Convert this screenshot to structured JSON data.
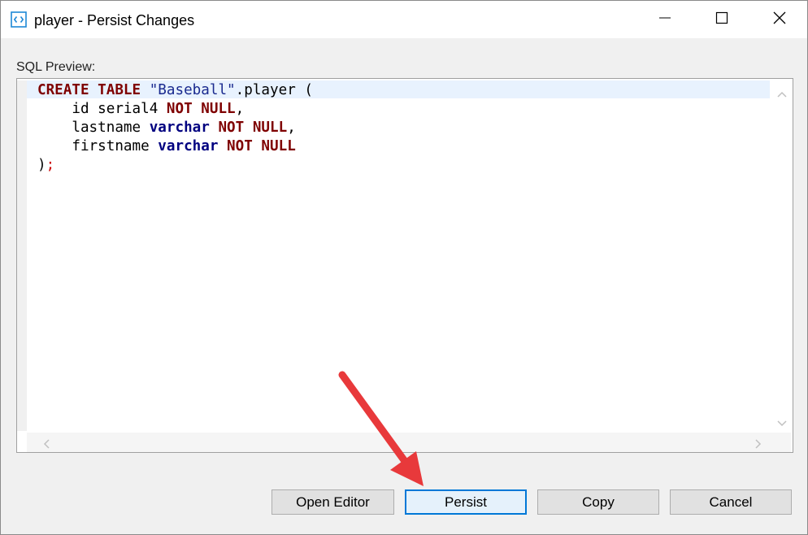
{
  "window": {
    "title": "player - Persist Changes",
    "icons": {
      "app": "code-brackets-icon",
      "minimize": "minimize-icon",
      "maximize": "maximize-icon",
      "close": "close-icon"
    }
  },
  "sql_preview": {
    "label": "SQL Preview:",
    "lines": [
      [
        {
          "t": "CREATE",
          "c": "kw"
        },
        {
          "t": " "
        },
        {
          "t": "TABLE",
          "c": "kw"
        },
        {
          "t": " "
        },
        {
          "t": "\"Baseball\"",
          "c": "str"
        },
        {
          "t": ".player ("
        }
      ],
      [
        {
          "t": "    id serial4 "
        },
        {
          "t": "NOT",
          "c": "kw"
        },
        {
          "t": " "
        },
        {
          "t": "NULL",
          "c": "kw"
        },
        {
          "t": ","
        }
      ],
      [
        {
          "t": "    lastname "
        },
        {
          "t": "varchar",
          "c": "typ"
        },
        {
          "t": " "
        },
        {
          "t": "NOT",
          "c": "kw"
        },
        {
          "t": " "
        },
        {
          "t": "NULL",
          "c": "kw"
        },
        {
          "t": ","
        }
      ],
      [
        {
          "t": "    firstname "
        },
        {
          "t": "varchar",
          "c": "typ"
        },
        {
          "t": " "
        },
        {
          "t": "NOT",
          "c": "kw"
        },
        {
          "t": " "
        },
        {
          "t": "NULL",
          "c": "kw"
        }
      ],
      [
        {
          "t": ")"
        },
        {
          "t": ";",
          "c": "semi"
        }
      ]
    ]
  },
  "buttons": {
    "open_editor": "Open Editor",
    "persist": "Persist",
    "copy": "Copy",
    "cancel": "Cancel"
  },
  "colors": {
    "keyword": "#7f0000",
    "type": "#000080",
    "string": "#1a2a8f",
    "current_line": "#e8f2fe",
    "annotation_arrow": "#e8393b",
    "default_button_border": "#0078d7"
  }
}
